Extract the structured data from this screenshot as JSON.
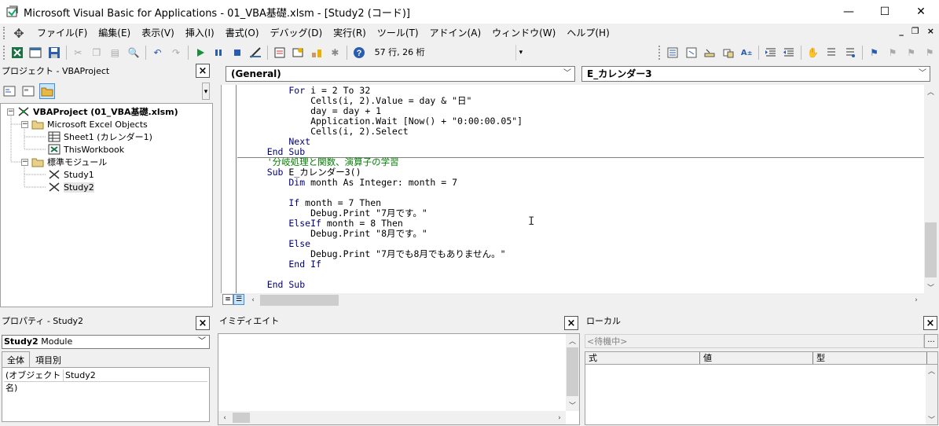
{
  "window": {
    "title": "Microsoft Visual Basic for Applications - 01_VBA基礎.xlsm - [Study2 (コード)]",
    "minimize": "—",
    "maximize": "☐",
    "close": "✕"
  },
  "menu": {
    "items": [
      "ファイル(F)",
      "編集(E)",
      "表示(V)",
      "挿入(I)",
      "書式(O)",
      "デバッグ(D)",
      "実行(R)",
      "ツール(T)",
      "アドイン(A)",
      "ウィンドウ(W)",
      "ヘルプ(H)"
    ],
    "mdi_min": "_",
    "mdi_restore": "❐",
    "mdi_close": "×"
  },
  "toolbar": {
    "cursor_position": "57 行, 26 桁"
  },
  "project": {
    "title": "プロジェクト - VBAProject",
    "close": "×",
    "tree": {
      "root": "VBAProject (01_VBA基礎.xlsm)",
      "excel_objects": "Microsoft Excel Objects",
      "sheet1": "Sheet1 (カレンダー1)",
      "thisworkbook": "ThisWorkbook",
      "modules": "標準モジュール",
      "study1": "Study1",
      "study2": "Study2"
    }
  },
  "code": {
    "object_combo": "(General)",
    "proc_combo": "E_カレンダー3",
    "lines": [
      {
        "kw": "        For",
        "rest": " i = 2 To 32"
      },
      {
        "kw": "",
        "rest": "            Cells(i, 2).Value = day & \"日\""
      },
      {
        "kw": "",
        "rest": "            day = day + 1"
      },
      {
        "kw": "",
        "rest": "            Application.Wait [Now() + \"0:00:00.05\"]"
      },
      {
        "kw": "",
        "rest": "            Cells(i, 2).Select"
      },
      {
        "kw": "        Next",
        "rest": ""
      },
      {
        "kw": "    End Sub",
        "rest": ""
      }
    ],
    "comment": "    '分岐処理と関数、演算子の学習",
    "lines2": [
      {
        "kw": "    Sub",
        "rest": " E_カレンダー3()"
      },
      {
        "kw": "        Dim",
        "rest": " month As Integer: month = 7"
      },
      {
        "kw": "",
        "rest": ""
      },
      {
        "kw": "        If",
        "rest": " month = 7 Then"
      },
      {
        "kw": "",
        "rest": "            Debug.Print \"7月です。\""
      },
      {
        "kw": "        ElseIf",
        "rest": " month = 8 Then"
      },
      {
        "kw": "",
        "rest": "            Debug.Print \"8月です。\""
      },
      {
        "kw": "        Else",
        "rest": ""
      },
      {
        "kw": "",
        "rest": "            Debug.Print \"7月でも8月でもありません。\""
      },
      {
        "kw": "        End If",
        "rest": ""
      },
      {
        "kw": "",
        "rest": ""
      },
      {
        "kw": "    End Sub",
        "rest": ""
      }
    ]
  },
  "properties": {
    "title": "プロパティ - Study2",
    "close": "×",
    "combo_name": "Study2",
    "combo_type": "Module",
    "tab_all": "全体",
    "tab_category": "項目別",
    "row_name": "(オブジェクト名)",
    "row_value": "Study2"
  },
  "immediate": {
    "title": "イミディエイト",
    "close": "×"
  },
  "locals": {
    "title": "ローカル",
    "close": "×",
    "status": "<待機中>",
    "button": "...",
    "col_expr": "式",
    "col_value": "値",
    "col_type": "型"
  }
}
